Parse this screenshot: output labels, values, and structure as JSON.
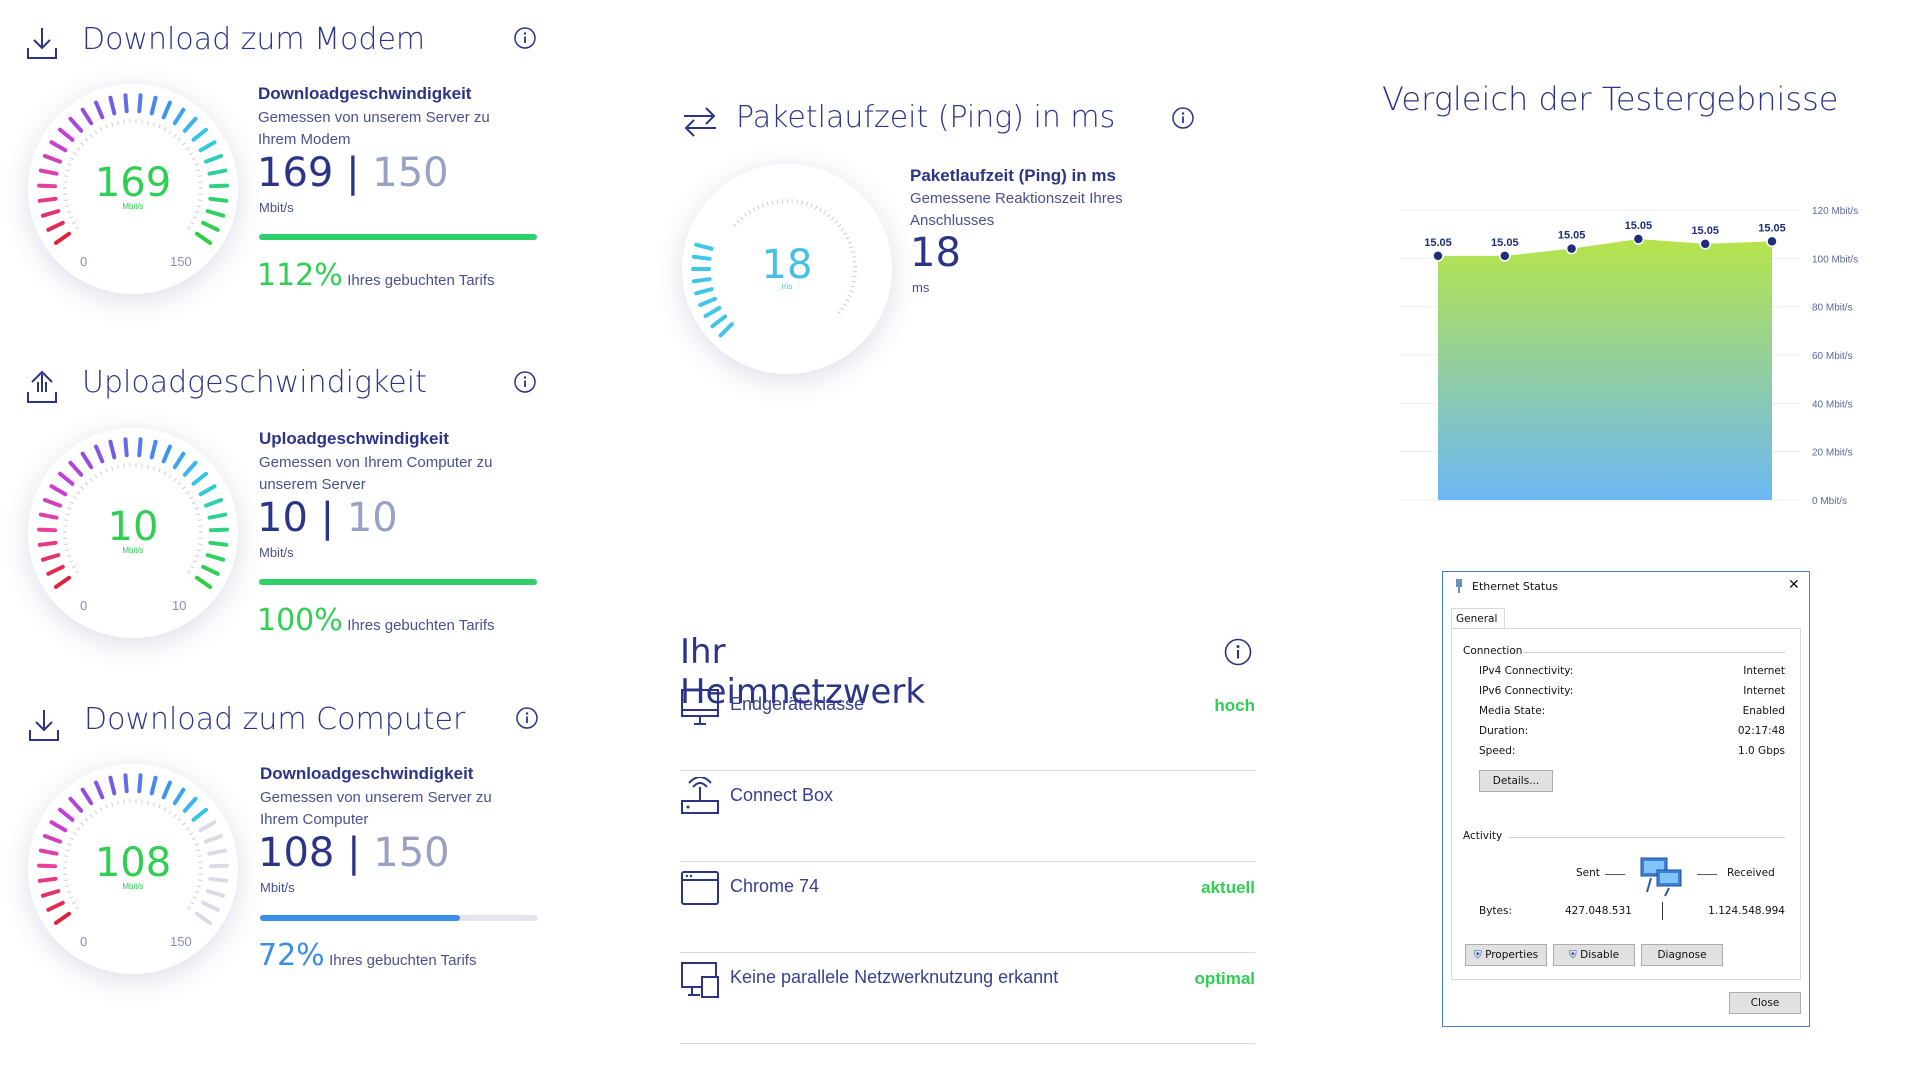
{
  "download_modem": {
    "title": "Download zum Modem",
    "gauge_value": "169",
    "gauge_unit": "Mbit/s",
    "scale_min": "0",
    "scale_max": "150",
    "heading": "Downloadgeschwindigkeit",
    "description": "Gemessen von unserem Server zu Ihrem Modem",
    "measured": "169",
    "separator": "|",
    "booked": "150",
    "unit": "Mbit/s",
    "percent": "112%",
    "percent_label": "Ihres gebuchten Tarifs",
    "bar_fraction": 1.0,
    "bar_color": "#2fcf6a",
    "icon": "download-icon"
  },
  "upload": {
    "title": "Uploadgeschwindigkeit",
    "gauge_value": "10",
    "gauge_unit": "Mbit/s",
    "scale_min": "0",
    "scale_max": "10",
    "heading": "Uploadgeschwindigkeit",
    "description": "Gemessen von Ihrem Computer zu unserem Server",
    "measured": "10",
    "separator": "|",
    "booked": "10",
    "unit": "Mbit/s",
    "percent": "100%",
    "percent_label": "Ihres gebuchten Tarifs",
    "bar_fraction": 1.0,
    "bar_color": "#2fcf6a",
    "icon": "upload-icon"
  },
  "download_computer": {
    "title": "Download zum Computer",
    "gauge_value": "108",
    "gauge_unit": "Mbit/s",
    "scale_min": "0",
    "scale_max": "150",
    "heading": "Downloadgeschwindigkeit",
    "description": "Gemessen von unserem Server zu Ihrem Computer",
    "measured": "108",
    "separator": "|",
    "booked": "150",
    "unit": "Mbit/s",
    "percent": "72%",
    "percent_label": "Ihres gebuchten Tarifs",
    "bar_fraction": 0.72,
    "bar_color": "#3a8ee8",
    "icon": "download-icon"
  },
  "ping": {
    "title": "Paketlaufzeit (Ping) in ms",
    "gauge_value": "18",
    "gauge_unit": "ms",
    "heading": "Paketlaufzeit (Ping) in ms",
    "description": "Gemessene Reaktionszeit Ihres Anschlusses",
    "measured": "18",
    "unit": "ms",
    "icon": "ping-arrows-icon"
  },
  "home_network": {
    "title": "Ihr Heimnetzwerk",
    "rows": [
      {
        "label": "Endgeräteklasse",
        "status": "hoch",
        "icon": "monitor-icon"
      },
      {
        "label": "Connect Box",
        "status": "",
        "icon": "router-icon"
      },
      {
        "label": "Chrome 74",
        "status": "aktuell",
        "icon": "browser-window-icon"
      },
      {
        "label": "Keine parallele Netzwerknutzung erkannt",
        "status": "optimal",
        "icon": "devices-icon"
      }
    ]
  },
  "comparison": {
    "title": "Vergleich der Testergebnisse"
  },
  "chart_data": {
    "type": "area",
    "title": "Vergleich der Testergebnisse",
    "categories": [
      "15.05",
      "15.05",
      "15.05",
      "15.05",
      "15.05",
      "15.05"
    ],
    "series": [
      {
        "values": [
          101,
          101,
          104,
          108,
          106,
          107
        ]
      }
    ],
    "y_ticks": [
      "120 Mbit/s",
      "100 Mbit/s",
      "80 Mbit/s",
      "60 Mbit/s",
      "40 Mbit/s",
      "20 Mbit/s",
      "0 Mbit/s"
    ],
    "ylim": [
      0,
      120
    ],
    "grid": true,
    "gradient_colors": [
      "#b6e44a",
      "#6cb8f5"
    ]
  },
  "ethernet": {
    "window_title": "Ethernet Status",
    "close_glyph": "✕",
    "tab": "General",
    "section_connection": "Connection",
    "rows": [
      {
        "label": "IPv4 Connectivity:",
        "value": "Internet"
      },
      {
        "label": "IPv6 Connectivity:",
        "value": "Internet"
      },
      {
        "label": "Media State:",
        "value": "Enabled"
      },
      {
        "label": "Duration:",
        "value": "02:17:48"
      },
      {
        "label": "Speed:",
        "value": "1.0 Gbps"
      }
    ],
    "details_button": "Details...",
    "section_activity": "Activity",
    "sent_label": "Sent",
    "received_label": "Received",
    "bytes_label": "Bytes:",
    "bytes_sent": "427.048.531",
    "bytes_received": "1.124.548.994",
    "properties_button": "Properties",
    "disable_button": "Disable",
    "diagnose_button": "Diagnose",
    "close_button": "Close"
  }
}
